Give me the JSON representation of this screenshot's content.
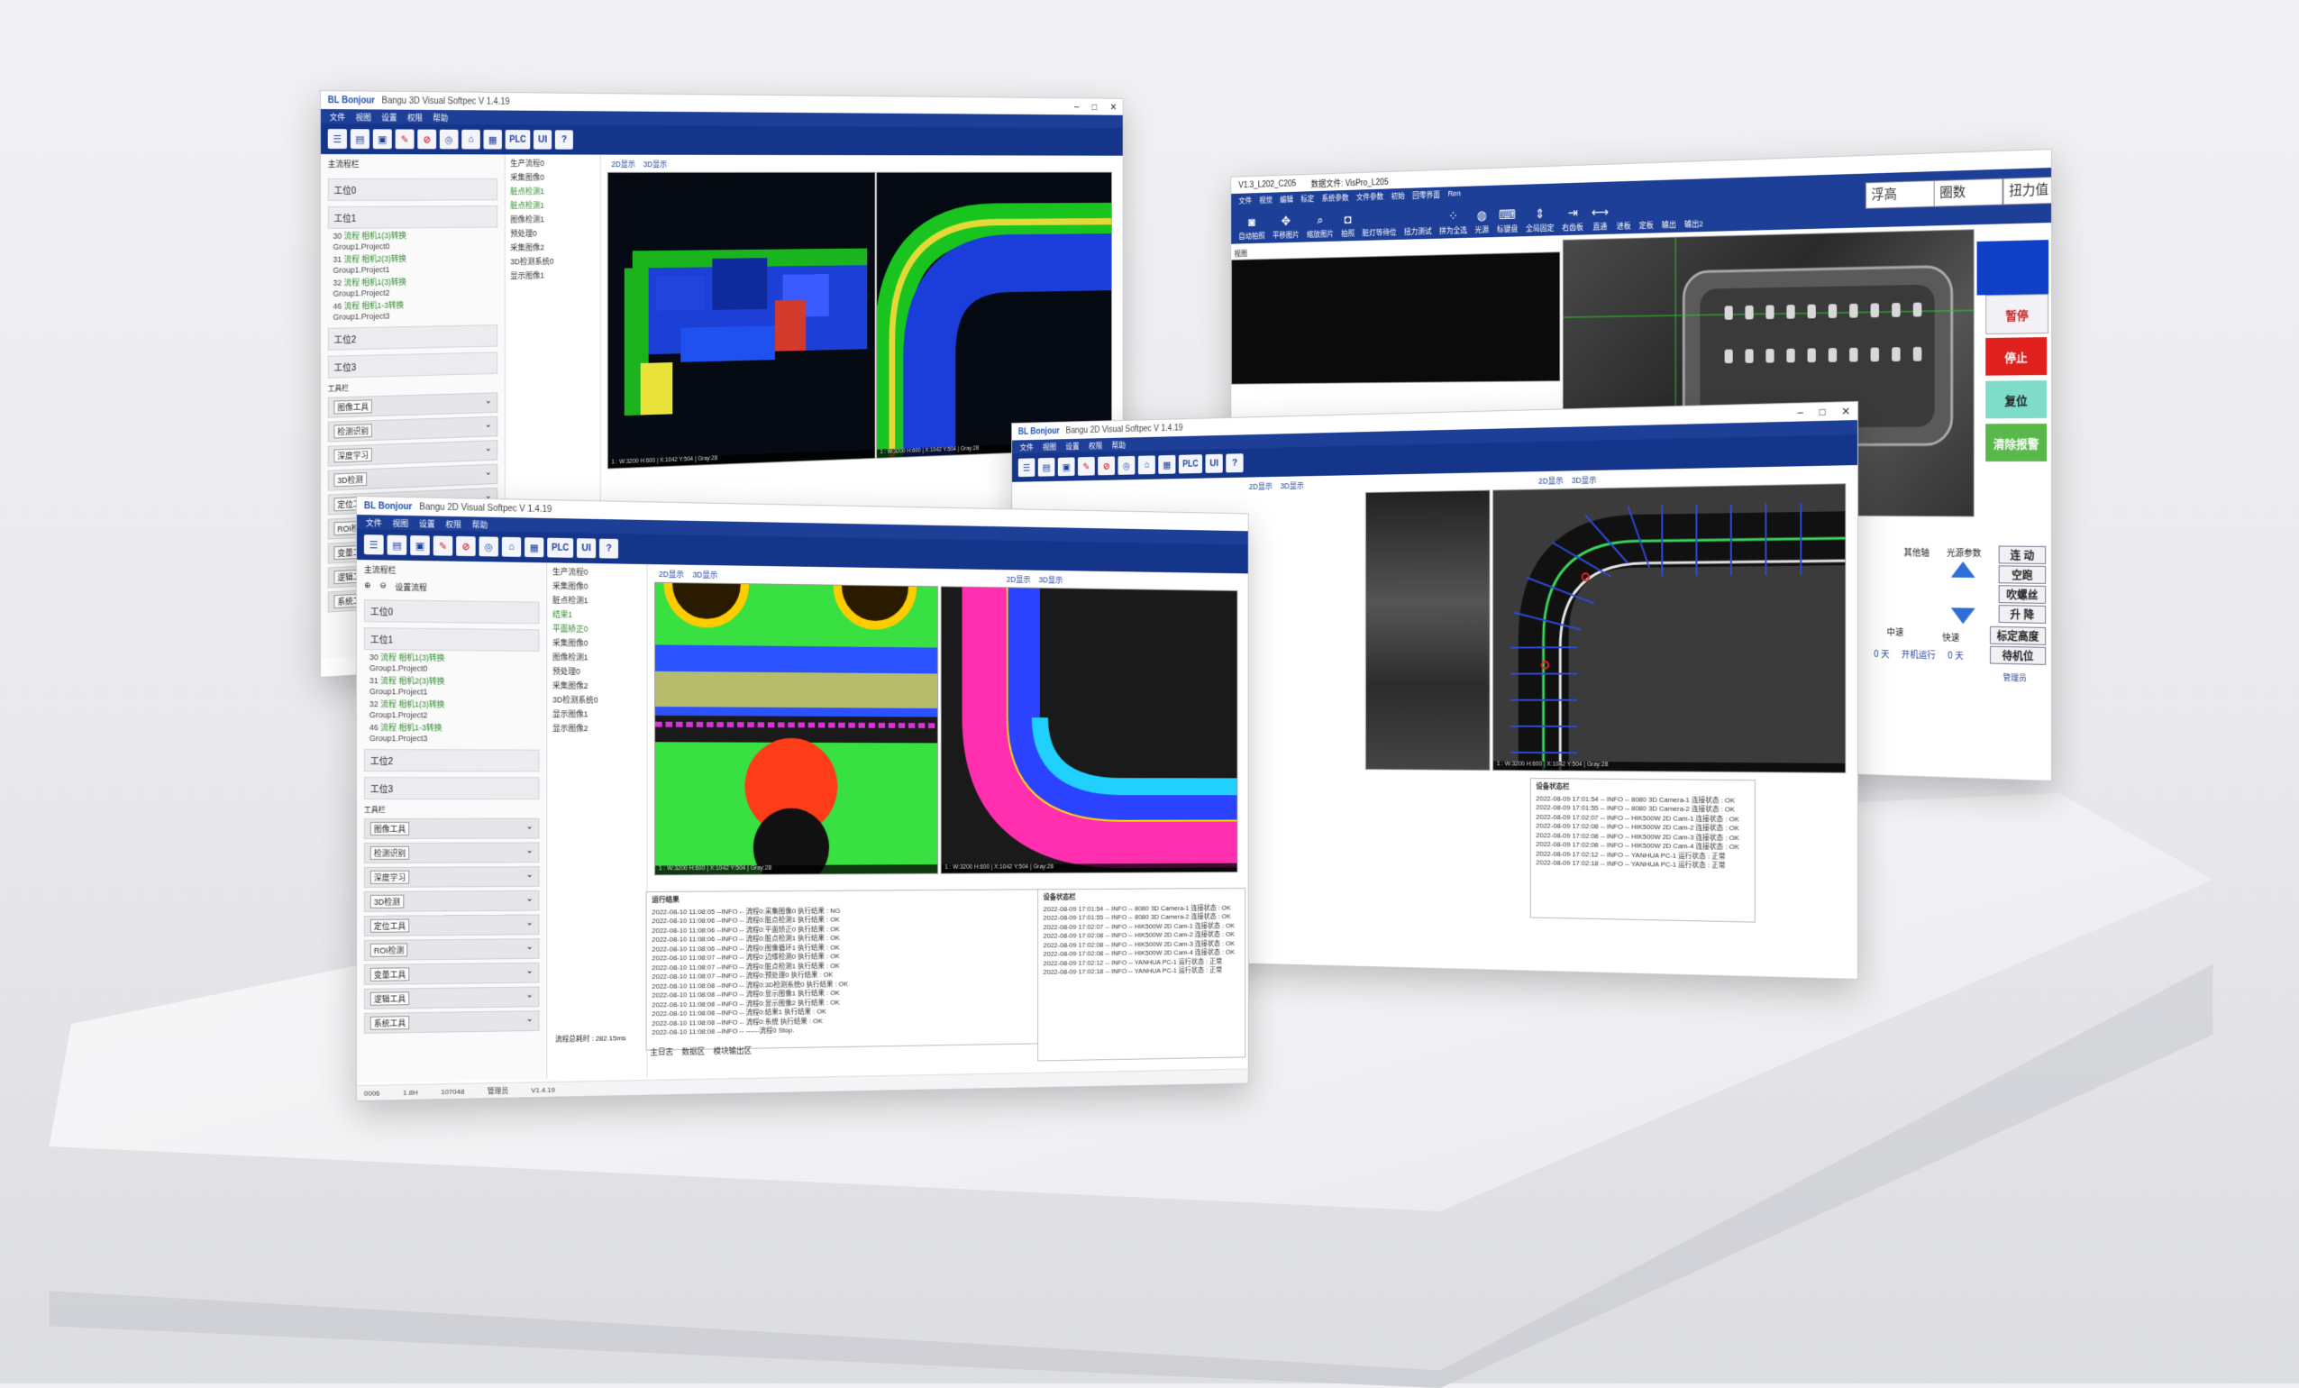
{
  "app": {
    "title": "Bangu 2D Visual Softpec  V 1.4.19",
    "title3d": "Bangu 3D Visual Softpec  V 1.4.19",
    "brand": "BL Bonjour",
    "menu": [
      "文件",
      "视图",
      "设置",
      "权限",
      "帮助"
    ],
    "toolbar_labels": [
      "UI",
      "PLC",
      "?"
    ]
  },
  "sidebar": {
    "header": "主流程栏",
    "settings_label": "设置流程",
    "station0": "工位0",
    "station1": "工位1",
    "station2": "工位2",
    "station3": "工位3",
    "items": [
      {
        "id": "30",
        "name": "流程 相机1(3)转换",
        "group": "Group1.Project0"
      },
      {
        "id": "31",
        "name": "流程 相机2(3)转换",
        "group": "Group1.Project1"
      },
      {
        "id": "32",
        "name": "流程 相机1(3)转换",
        "group": "Group1.Project2"
      },
      {
        "id": "46",
        "name": "流程 相机1-3转换",
        "group": "Group1.Project3"
      }
    ],
    "tools_header": "工具栏",
    "tools": [
      "图像工具",
      "检测识别",
      "深度学习",
      "3D检测",
      "定位工具",
      "ROI检测",
      "变量工具",
      "逻辑工具",
      "系统工具"
    ]
  },
  "midpanel": {
    "header": "生产流程0",
    "nodes": [
      "采集图像0",
      "脏点检测1",
      "采集图像0",
      "图像检测1",
      "预处理0",
      "采集图像2",
      "3D检测系统0",
      "显示图像1",
      "显示图像2"
    ],
    "sub": [
      "结果1",
      "脏点检测1",
      "平面矫正0"
    ]
  },
  "views": {
    "tab_2d": "2D显示",
    "tab_3d": "3D显示",
    "caption": "1 : W:3200 H:600 | X:1042 Y:504 | Gray:28"
  },
  "log_left": {
    "header": "运行结果",
    "lines": [
      "2022-08-10 11:08:05 --INFO -- 流程0:采集图像0 执行结果 : NG",
      "2022-08-10 11:08:06 --INFO -- 流程0:脏点检测1 执行结果 : OK",
      "2022-08-10 11:08:06 --INFO -- 流程0:平面矫正0 执行结果 : OK",
      "2022-08-10 11:08:06 --INFO -- 流程0:脏点检测1 执行结果 : OK",
      "2022-08-10 11:08:06 --INFO -- 流程0:图像循环1 执行结果 : OK",
      "2022-08-10 11:08:07 --INFO -- 流程0:边缘检测0 执行结果 : OK",
      "2022-08-10 11:08:07 --INFO -- 流程0:脏点检测1 执行结果 : OK",
      "2022-08-10 11:08:07 --INFO -- 流程0:预处理0 执行结果 : OK",
      "2022-08-10 11:08:08 --INFO -- 流程0:3D检测系统0 执行结果 : OK",
      "2022-08-10 11:08:08 --INFO -- 流程0:显示图像1 执行结果 : OK",
      "2022-08-10 11:08:08 --INFO -- 流程0:显示图像2 执行结果 : OK",
      "2022-08-10 11:08:08 --INFO -- 流程0:结果1 执行结果 : OK",
      "2022-08-10 11:08:08 --INFO -- 流程0:系统 执行结果 : OK",
      "2022-08-10 11:08:08 --INFO -- ------流程0 Stop."
    ]
  },
  "log_right": {
    "header": "设备状态栏",
    "lines": [
      "2022-08-09 17:01:54 -- INFO -- 8080 3D Camera-1 连接状态 : OK",
      "2022-08-09 17:01:55 -- INFO -- 8080 3D Camera-2 连接状态 : OK",
      "2022-08-09 17:02:07 -- INFO -- HIK500W 2D Cam-1 连接状态 : OK",
      "2022-08-09 17:02:08 -- INFO -- HIK500W 2D Cam-2 连接状态 : OK",
      "2022-08-09 17:02:08 -- INFO -- HIK500W 2D Cam-3 连接状态 : OK",
      "2022-08-09 17:02:08 -- INFO -- HIK500W 2D Cam-4 连接状态 : OK",
      "2022-08-09 17:02:12 -- INFO -- YANHUA PC-1 运行状态 : 正常",
      "2022-08-09 17:02:18 -- INFO -- YANHUA PC-1 运行状态 : 正常"
    ]
  },
  "bottom_tabs": [
    "主日志",
    "数据区",
    "模块输出区"
  ],
  "status": {
    "version": "V1.4.19",
    "counter": "0006",
    "run_time": "1.8H",
    "count": "107048",
    "cycle": "流程总耗时 : 282.15ms",
    "user": "管理员"
  },
  "vispro": {
    "title": "V1.3_L202_C205",
    "subtitle": "数据文件: VisPro_L205",
    "menu": [
      "文件",
      "视觉",
      "编辑",
      "标定",
      "系统参数",
      "文件参数",
      "初始",
      "回零界面",
      "Ren"
    ],
    "tools": [
      "自动拍照",
      "平移图片",
      "缩放图片",
      "拍照",
      "脏灯等待位",
      "扭力测试",
      "拼为全选",
      "光源",
      "标键盘",
      "全局固定",
      "右齿板",
      "直通",
      "进板",
      "定板",
      "输出",
      "输出2"
    ],
    "hdr": [
      "浮高",
      "圈数",
      "扭力值"
    ],
    "view_label": "视图",
    "buttons": {
      "pause": "暂停",
      "stop": "停止",
      "reset": "复位",
      "clear": "清除报警"
    },
    "params": {
      "light": "光源参数",
      "other": "其他轴",
      "mid": "中速",
      "fast": "快速",
      "run_days": "开机运行",
      "days0": "0 天",
      "days1": "0 天"
    },
    "side": [
      "连 动",
      "空跑",
      "吹螺丝",
      "升 降",
      "标定高度",
      "待机位",
      "管理员"
    ]
  },
  "colors": {
    "brand": "#1d3f98",
    "stop": "#e0201c",
    "reset": "#7fdcc8",
    "clear": "#58b84a",
    "blue_button": "#1040c8"
  }
}
